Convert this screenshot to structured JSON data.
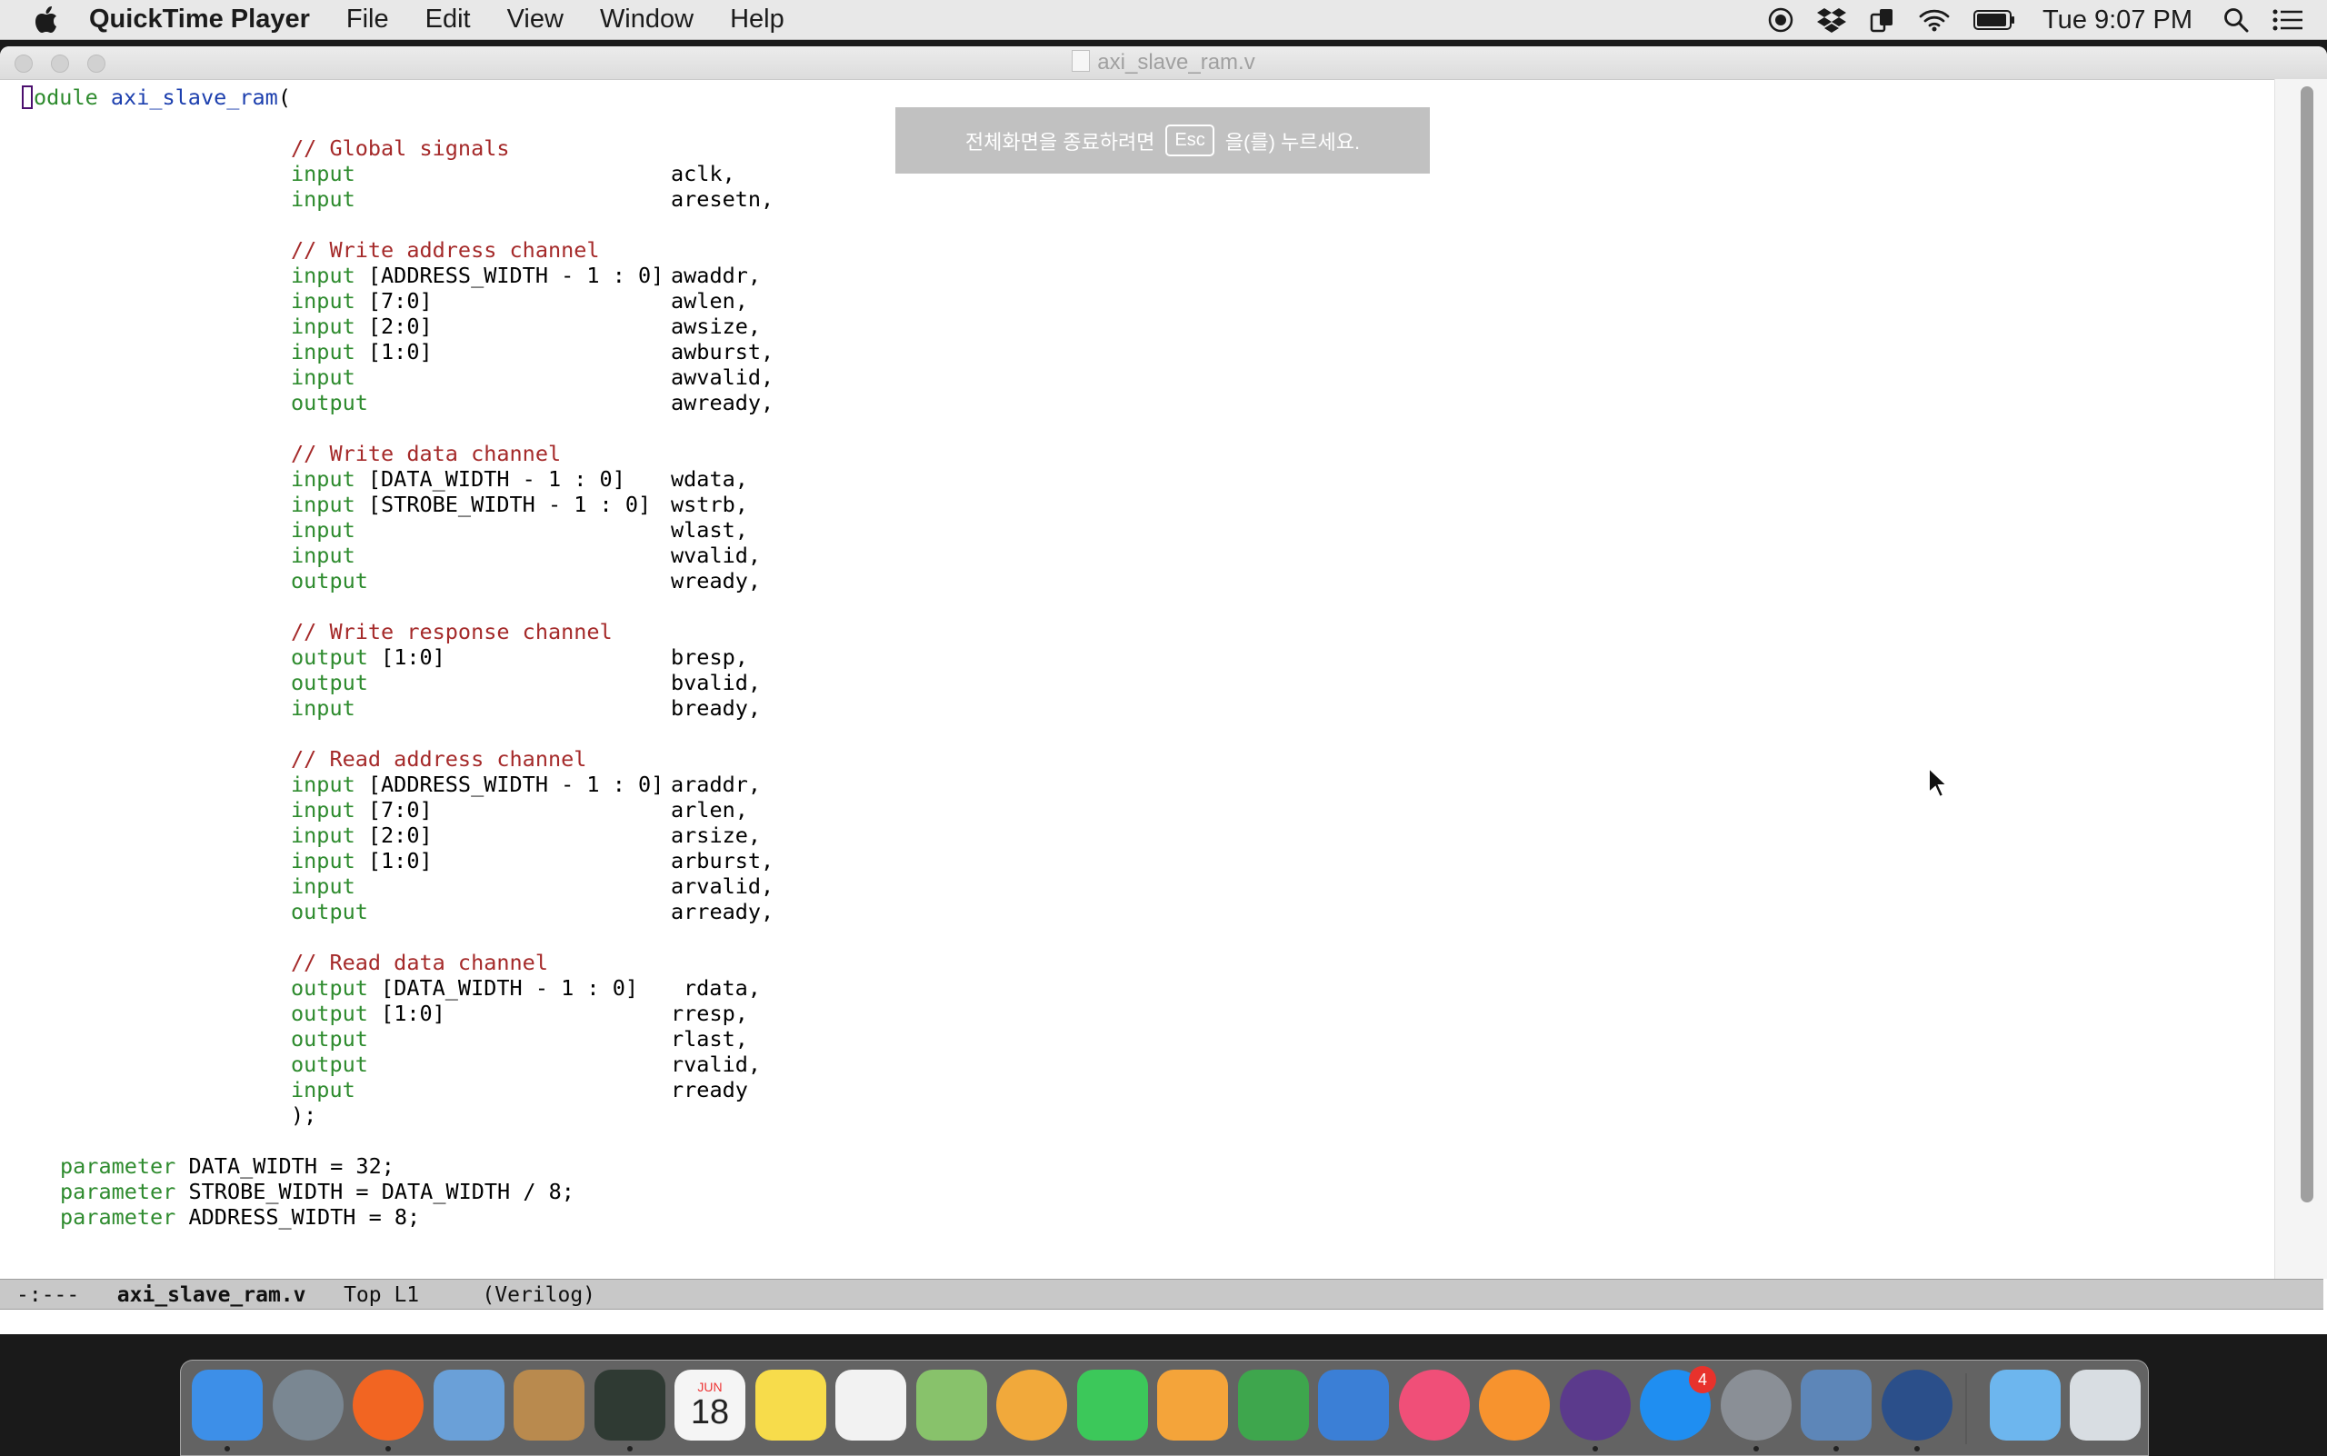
{
  "menubar": {
    "apple_icon": "apple-logo-icon",
    "app_name": "QuickTime Player",
    "menus": [
      "File",
      "Edit",
      "View",
      "Window",
      "Help"
    ],
    "status_icons": [
      "screen-record-icon",
      "dropbox-icon",
      "sync-icon",
      "wifi-icon",
      "battery-icon"
    ],
    "clock": "Tue 9:07 PM",
    "right_icons": [
      "spotlight-search-icon",
      "notification-center-icon"
    ]
  },
  "window": {
    "title": "axi_slave_ram.v",
    "fullscreen_hint": {
      "text_before": "전체화면을 종료하려면",
      "key": "Esc",
      "text_after": "을(를) 누르세요."
    }
  },
  "code": {
    "module_kw": "module",
    "module_kw_rest": "odule",
    "module_name": "axi_slave_ram",
    "module_open": "(",
    "sections": [
      {
        "comment": "// Global signals",
        "ports": [
          {
            "dir": "input",
            "range": "",
            "name": "aclk,"
          },
          {
            "dir": "input",
            "range": "",
            "name": "aresetn,"
          }
        ]
      },
      {
        "comment": "// Write address channel",
        "ports": [
          {
            "dir": "input",
            "range": "[ADDRESS_WIDTH - 1 : 0]",
            "name": "awaddr,"
          },
          {
            "dir": "input",
            "range": "[7:0]",
            "name": "awlen,"
          },
          {
            "dir": "input",
            "range": "[2:0]",
            "name": "awsize,"
          },
          {
            "dir": "input",
            "range": "[1:0]",
            "name": "awburst,"
          },
          {
            "dir": "input",
            "range": "",
            "name": "awvalid,"
          },
          {
            "dir": "output",
            "range": "",
            "name": "awready,"
          }
        ]
      },
      {
        "comment": "// Write data channel",
        "ports": [
          {
            "dir": "input",
            "range": "[DATA_WIDTH - 1 : 0]",
            "name": "wdata,"
          },
          {
            "dir": "input",
            "range": "[STROBE_WIDTH - 1 : 0]",
            "name": "wstrb,"
          },
          {
            "dir": "input",
            "range": "",
            "name": "wlast,"
          },
          {
            "dir": "input",
            "range": "",
            "name": "wvalid,"
          },
          {
            "dir": "output",
            "range": "",
            "name": "wready,"
          }
        ]
      },
      {
        "comment": "// Write response channel",
        "ports": [
          {
            "dir": "output",
            "range": "[1:0]",
            "name": "bresp,"
          },
          {
            "dir": "output",
            "range": "",
            "name": "bvalid,"
          },
          {
            "dir": "input",
            "range": "",
            "name": "bready,"
          }
        ]
      },
      {
        "comment": "// Read address channel",
        "ports": [
          {
            "dir": "input",
            "range": "[ADDRESS_WIDTH - 1 : 0]",
            "name": "araddr,"
          },
          {
            "dir": "input",
            "range": "[7:0]",
            "name": "arlen,"
          },
          {
            "dir": "input",
            "range": "[2:0]",
            "name": "arsize,"
          },
          {
            "dir": "input",
            "range": "[1:0]",
            "name": "arburst,"
          },
          {
            "dir": "input",
            "range": "",
            "name": "arvalid,"
          },
          {
            "dir": "output",
            "range": "",
            "name": "arready,"
          }
        ]
      },
      {
        "comment": "// Read data channel",
        "ports": [
          {
            "dir": "output",
            "range": "[DATA_WIDTH - 1 : 0]",
            "name": "rdata,"
          },
          {
            "dir": "output",
            "range": "[1:0]",
            "name": "rresp,"
          },
          {
            "dir": "output",
            "range": "",
            "name": "rlast,"
          },
          {
            "dir": "output",
            "range": "",
            "name": "rvalid,"
          },
          {
            "dir": "input",
            "range": "",
            "name": "rready"
          }
        ]
      }
    ],
    "close": ");",
    "parameters": [
      {
        "kw": "parameter",
        "text": "DATA_WIDTH = 32;"
      },
      {
        "kw": "parameter",
        "text": "STROBE_WIDTH = DATA_WIDTH / 8;"
      },
      {
        "kw": "parameter",
        "text": "ADDRESS_WIDTH = 8;"
      }
    ]
  },
  "modeline": {
    "status": "-:---",
    "filename": "axi_slave_ram.v",
    "position": "Top L1",
    "mode": "(Verilog)"
  },
  "dock": {
    "apps": [
      {
        "name": "finder-icon",
        "color": "#3d8fe8",
        "running": true
      },
      {
        "name": "launchpad-icon",
        "color": "#7a8792",
        "running": false
      },
      {
        "name": "firefox-icon",
        "color": "#f26522",
        "running": true
      },
      {
        "name": "mail-icon",
        "color": "#6aa0d8",
        "running": false
      },
      {
        "name": "contacts-icon",
        "color": "#b98a4e",
        "running": false
      },
      {
        "name": "activity-monitor-icon",
        "color": "#2f3a33",
        "running": true
      },
      {
        "name": "calendar-icon",
        "color": "#f5f5f5",
        "running": false,
        "label_top": "JUN",
        "label": "18"
      },
      {
        "name": "notes-icon",
        "color": "#f7dc4b",
        "running": false
      },
      {
        "name": "reminders-icon",
        "color": "#f2f2f2",
        "running": false
      },
      {
        "name": "maps-icon",
        "color": "#88c26b",
        "running": false
      },
      {
        "name": "photos-icon",
        "color": "#f1a93b",
        "running": false
      },
      {
        "name": "facetime-icon",
        "color": "#3cc85a",
        "running": false
      },
      {
        "name": "pages-icon",
        "color": "#f4a43a",
        "running": false
      },
      {
        "name": "numbers-icon",
        "color": "#3ea64d",
        "running": false
      },
      {
        "name": "keynote-icon",
        "color": "#3b7fd6",
        "running": false
      },
      {
        "name": "itunes-icon",
        "color": "#f04f78",
        "running": false
      },
      {
        "name": "ibooks-icon",
        "color": "#f7932e",
        "running": false
      },
      {
        "name": "emacs-icon",
        "color": "#5b3a8c",
        "running": true
      },
      {
        "name": "app-store-icon",
        "color": "#1f8ef1",
        "running": false,
        "badge": "4"
      },
      {
        "name": "system-preferences-icon",
        "color": "#8a8f96",
        "running": true
      },
      {
        "name": "preview-icon",
        "color": "#5d86b8",
        "running": true
      },
      {
        "name": "quicktime-icon",
        "color": "#2b4f8a",
        "running": true
      },
      {
        "name": "downloads-folder-icon",
        "color": "#6db6ee",
        "running": false
      },
      {
        "name": "trash-icon",
        "color": "#d8dde2",
        "running": false
      }
    ]
  },
  "colors": {
    "keyword": "#2e8b2e",
    "comment": "#a52a2a",
    "function_name": "#1c3fae",
    "modeline_bg": "#c8c8c8"
  }
}
